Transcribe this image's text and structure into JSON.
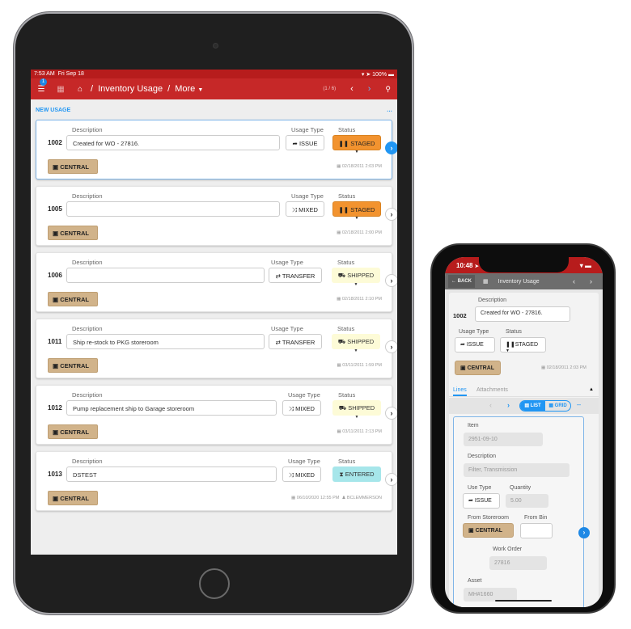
{
  "tablet": {
    "status_bar": {
      "time": "7:53 AM",
      "date": "Fri Sep 18",
      "battery": "100%"
    },
    "nav": {
      "menu_badge": "1",
      "breadcrumb": [
        "Inventory Usage",
        "More"
      ],
      "pager": "(1 / 6)"
    },
    "section_title": "NEW USAGE",
    "section_menu": "…",
    "labels": {
      "description": "Description",
      "usage_type": "Usage Type",
      "status": "Status"
    },
    "cards": [
      {
        "id": "1002",
        "description": "Created for WO - 27816.",
        "usage_type": "ISSUE",
        "usage_icon": "share-icon",
        "status": "STAGED",
        "status_icon": "pause-icon",
        "storeroom": "CENTRAL",
        "date": "02/18/2011 2:03 PM",
        "user": "",
        "active": true
      },
      {
        "id": "1005",
        "description": "",
        "usage_type": "MIXED",
        "usage_icon": "shuffle-icon",
        "status": "STAGED",
        "status_icon": "pause-icon",
        "storeroom": "CENTRAL",
        "date": "02/18/2011 2:00 PM",
        "user": "",
        "active": false
      },
      {
        "id": "1006",
        "description": "",
        "usage_type": "TRANSFER",
        "usage_icon": "exchange-icon",
        "status": "SHIPPED",
        "status_icon": "truck-icon",
        "storeroom": "CENTRAL",
        "date": "02/18/2011 2:10 PM",
        "user": "",
        "active": false
      },
      {
        "id": "1011",
        "description": "Ship re-stock to PKG storeroom",
        "usage_type": "TRANSFER",
        "usage_icon": "exchange-icon",
        "status": "SHIPPED",
        "status_icon": "truck-icon",
        "storeroom": "CENTRAL",
        "date": "03/11/2011 1:59 PM",
        "user": "",
        "active": false
      },
      {
        "id": "1012",
        "description": "Pump replacement ship to Garage storeroom",
        "usage_type": "MIXED",
        "usage_icon": "shuffle-icon",
        "status": "SHIPPED",
        "status_icon": "truck-icon",
        "storeroom": "CENTRAL",
        "date": "03/11/2011 2:13 PM",
        "user": "",
        "active": false
      },
      {
        "id": "1013",
        "description": "DSTEST",
        "usage_type": "MIXED",
        "usage_icon": "shuffle-icon",
        "status": "ENTERED",
        "status_icon": "hourglass-icon",
        "storeroom": "CENTRAL",
        "date": "06/10/2020 12:55 PM",
        "user": "BCLEMMERSON",
        "active": false
      }
    ]
  },
  "phone": {
    "status_bar": {
      "time": "10:48"
    },
    "nav": {
      "back": "BACK",
      "title": "Inventory Usage"
    },
    "record": {
      "id": "1002",
      "description_label": "Description",
      "description": "Created for WO - 27816.",
      "usage_type_label": "Usage Type",
      "usage_type": "ISSUE",
      "status_label": "Status",
      "status": "STAGED",
      "storeroom": "CENTRAL",
      "date": "02/18/2011 2:03 PM"
    },
    "tabs": [
      "Lines",
      "Attachments"
    ],
    "view_toggle": {
      "list": "LIST",
      "grid": "GRID",
      "selected": "LIST"
    },
    "line": {
      "item_label": "Item",
      "item": "2951-09-10",
      "description_label": "Description",
      "description": "Filter, Transmission",
      "use_type_label": "Use Type",
      "use_type": "ISSUE",
      "quantity_label": "Quantity",
      "quantity": "5.00",
      "from_storeroom_label": "From Storeroom",
      "from_storeroom": "CENTRAL",
      "from_bin_label": "From Bin",
      "from_bin": "",
      "work_order_label": "Work Order",
      "work_order": "27816",
      "asset_label": "Asset",
      "asset": "MH#1660"
    }
  },
  "colors": {
    "brand_red": "#c62828",
    "staged": "#f2932f",
    "shipped": "#fdfbd7",
    "entered": "#a6e6ea",
    "storeroom": "#d1b38a",
    "accent_blue": "#2196f3"
  }
}
